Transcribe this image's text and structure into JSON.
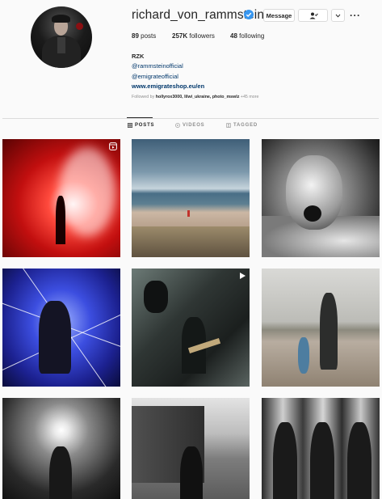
{
  "profile": {
    "username": "richard_von_rammstein",
    "message_label": "Message",
    "more_label": "···",
    "stats": {
      "posts": "89",
      "posts_label": "posts",
      "followers": "257K",
      "followers_label": "followers",
      "following": "48",
      "following_label": "following"
    },
    "bio": {
      "name": "RZK",
      "mention1": "@rammsteinofficial",
      "mention2": "@emigrateofficial",
      "link": "www.emigrateshop.eu/en"
    },
    "followed_by": {
      "prefix": "Followed by",
      "names": "hollyrox3000, lilwi_ukraine, photo_mswlz",
      "more": "+45 more"
    }
  },
  "tabs": [
    {
      "label": "POSTS",
      "icon": "grid-icon",
      "active": true
    },
    {
      "label": "VIDEOS",
      "icon": "video-icon",
      "active": false
    },
    {
      "label": "TAGGED",
      "icon": "tagged-icon",
      "active": false
    }
  ],
  "grid": {
    "rows": 3,
    "columns": 3,
    "tile_icons": [
      "reel-icon",
      null,
      null,
      null,
      "video-icon",
      null,
      null,
      null,
      null
    ]
  },
  "colors": {
    "link": "#00376b",
    "verified": "#3897f0",
    "muted": "#8e8e8e",
    "border": "#dbdbdb",
    "text": "#262626"
  }
}
